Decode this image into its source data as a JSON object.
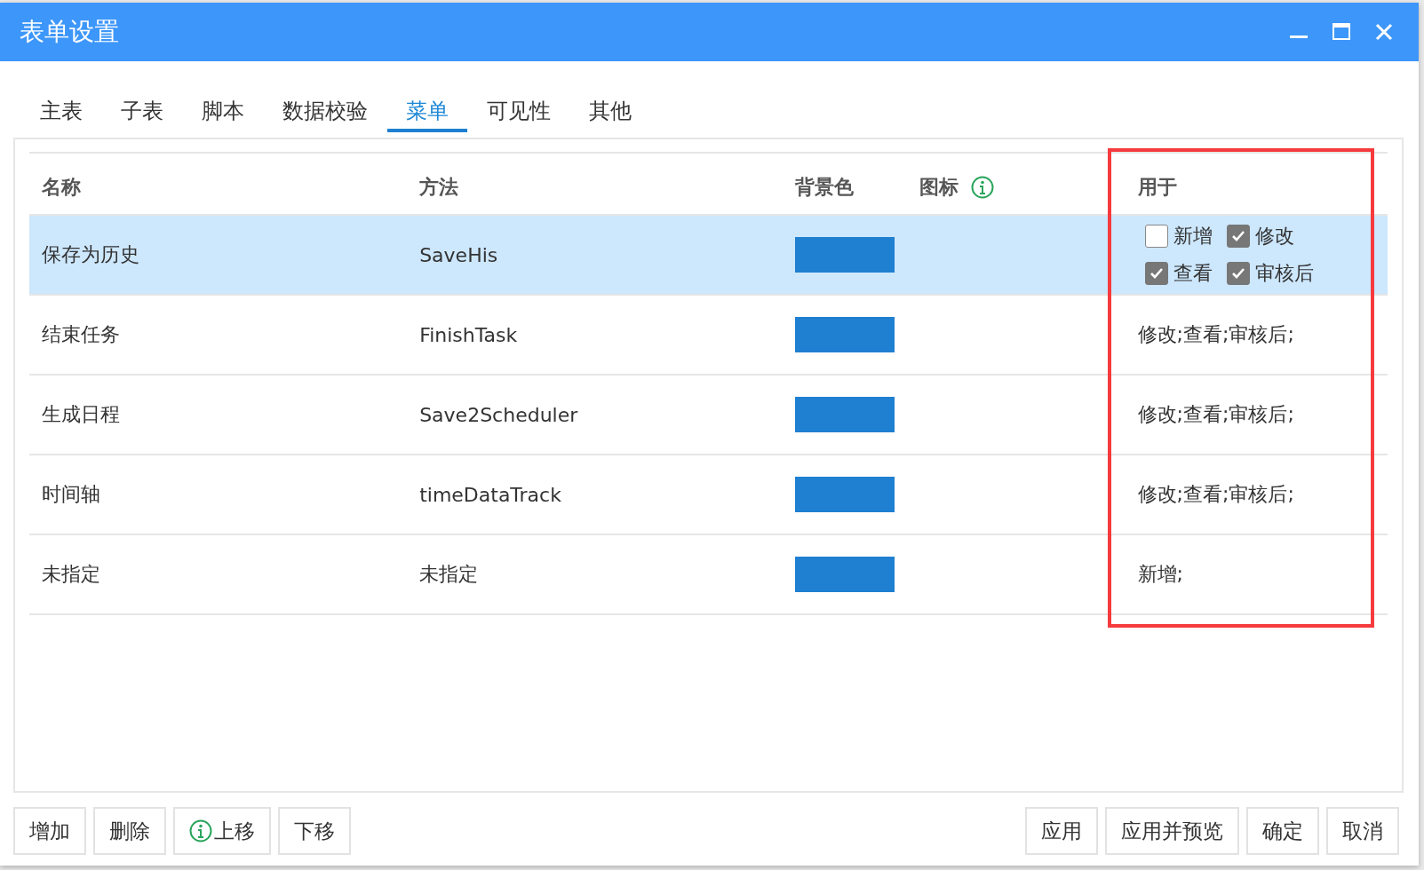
{
  "window": {
    "title": "表单设置"
  },
  "tabs": [
    {
      "label": "主表",
      "selected": false
    },
    {
      "label": "子表",
      "selected": false
    },
    {
      "label": "脚本",
      "selected": false
    },
    {
      "label": "数据校验",
      "selected": false
    },
    {
      "label": "菜单",
      "selected": true
    },
    {
      "label": "可见性",
      "selected": false
    },
    {
      "label": "其他",
      "selected": false
    }
  ],
  "table": {
    "columns": [
      "名称",
      "方法",
      "背景色",
      "图标",
      "用于"
    ],
    "rows": [
      {
        "name": "保存为历史",
        "method": "SaveHis",
        "color": "#1f7fd1",
        "selected": true,
        "kind": "checkboxes",
        "used_for": [
          {
            "label": "新增",
            "checked": false
          },
          {
            "label": "修改",
            "checked": true
          },
          {
            "label": "查看",
            "checked": true
          },
          {
            "label": "审核后",
            "checked": true
          }
        ]
      },
      {
        "name": "结束任务",
        "method": "FinishTask",
        "color": "#1f7fd1",
        "selected": false,
        "kind": "text",
        "used_for": "修改;查看;审核后;"
      },
      {
        "name": "生成日程",
        "method": "Save2Scheduler",
        "color": "#1f7fd1",
        "selected": false,
        "kind": "text",
        "used_for": "修改;查看;审核后;"
      },
      {
        "name": "时间轴",
        "method": "timeDataTrack",
        "color": "#1f7fd1",
        "selected": false,
        "kind": "text",
        "used_for": "修改;查看;审核后;"
      },
      {
        "name": "未指定",
        "method": "未指定",
        "color": "#1f7fd1",
        "selected": false,
        "kind": "text",
        "used_for": "新增;"
      }
    ]
  },
  "left_buttons": [
    {
      "label": "增加",
      "icon": false
    },
    {
      "label": "删除",
      "icon": false
    },
    {
      "label": "上移",
      "icon": true
    },
    {
      "label": "下移",
      "icon": false
    }
  ],
  "right_buttons": [
    "应用",
    "应用并预览",
    "确定",
    "取消"
  ]
}
